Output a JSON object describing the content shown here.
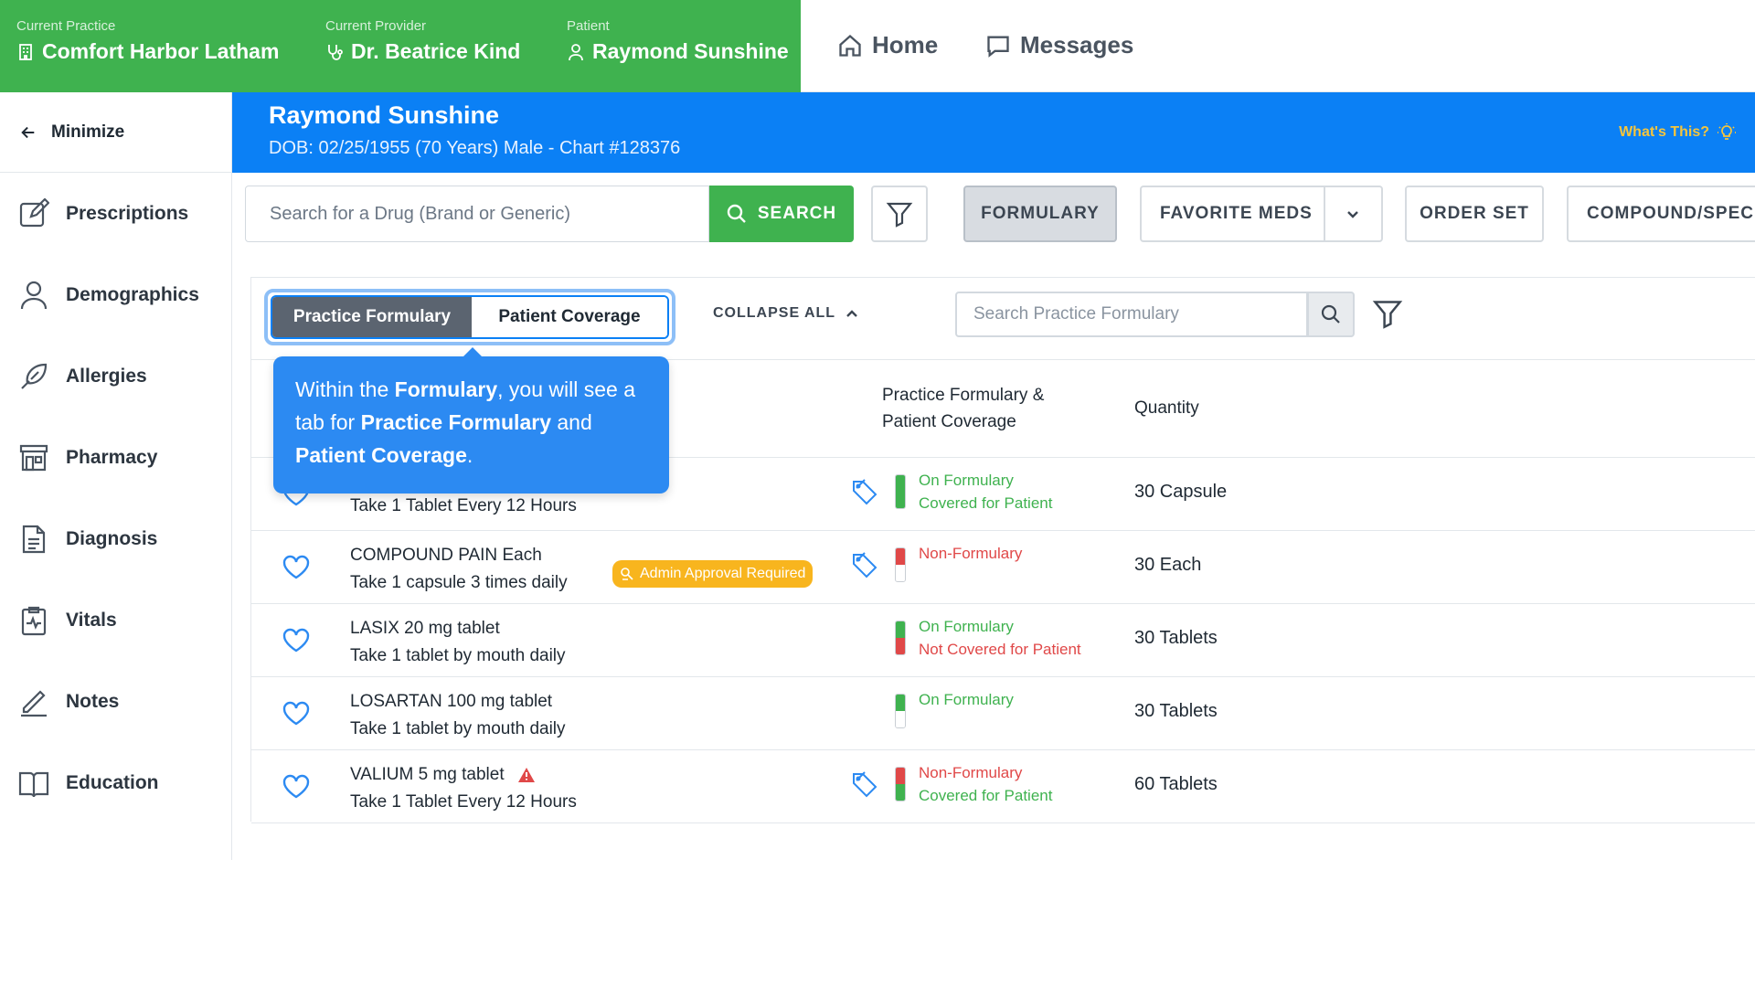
{
  "context": {
    "practice_label": "Current Practice",
    "practice": "Comfort Harbor Latham",
    "provider_label": "Current Provider",
    "provider": "Dr. Beatrice Kind",
    "patient_label": "Patient",
    "patient": "Raymond Sunshine"
  },
  "topnav": {
    "home": "Home",
    "messages": "Messages"
  },
  "sidebar": {
    "minimize": "Minimize",
    "items": [
      {
        "label": "Prescriptions",
        "icon": "edit-icon"
      },
      {
        "label": "Demographics",
        "icon": "user-icon"
      },
      {
        "label": "Allergies",
        "icon": "allergy-icon"
      },
      {
        "label": "Pharmacy",
        "icon": "pharmacy-icon"
      },
      {
        "label": "Diagnosis",
        "icon": "document-icon"
      },
      {
        "label": "Vitals",
        "icon": "vitals-icon"
      },
      {
        "label": "Notes",
        "icon": "pen-icon"
      },
      {
        "label": "Education",
        "icon": "book-icon"
      }
    ]
  },
  "banner": {
    "name": "Raymond Sunshine",
    "info": "DOB: 02/25/1955 (70 Years) Male - Chart #128376",
    "whats_this": "What's This?"
  },
  "toolbar": {
    "search_placeholder": "Search for a Drug (Brand or Generic)",
    "search_label": "SEARCH",
    "formulary": "FORMULARY",
    "favorite_meds": "FAVORITE MEDS",
    "order_set": "ORDER SET",
    "compound": "COMPOUND/SPECI"
  },
  "formulary": {
    "tab_practice": "Practice Formulary",
    "tab_patient": "Patient Coverage",
    "collapse_all": "COLLAPSE ALL",
    "search_placeholder": "Search Practice Formulary",
    "col_coverage_1": "Practice Formulary &",
    "col_coverage_2": "Patient Coverage",
    "col_quantity": "Quantity",
    "rows": [
      {
        "name": "",
        "strength": "",
        "sig": "Take 1 Tablet Every 12 Hours",
        "status1": "On Formulary",
        "status2": "Covered for Patient",
        "qty": "30 Capsule"
      },
      {
        "name": "COMPOUND PAIN",
        "strength": " Each",
        "sig": "Take 1 capsule 3 times daily",
        "badge": "Admin Approval Required",
        "status1": "Non-Formulary",
        "status2": "",
        "qty": "30 Each"
      },
      {
        "name": "LASIX",
        "strength": " 20 mg tablet",
        "sig": "Take 1 tablet by mouth daily",
        "status1": "On Formulary",
        "status2": "Not Covered for Patient",
        "qty": "30 Tablets"
      },
      {
        "name": "LOSARTAN",
        "strength": " 100 mg tablet",
        "sig": "Take 1 tablet by mouth daily",
        "status1": "On Formulary",
        "status2": "",
        "qty": "30 Tablets"
      },
      {
        "name": "VALIUM",
        "strength": " 5 mg tablet",
        "sig": "Take 1 Tablet Every 12 Hours",
        "status1": "Non-Formulary",
        "status2": "Covered for Patient",
        "qty": "60 Tablets"
      }
    ]
  },
  "tooltip": {
    "p1": "Within the ",
    "b1": "Formulary",
    "p2": ", you will see a tab for ",
    "b2": "Practice Formulary",
    "p3": " and ",
    "b3": "Patient Coverage",
    "p4": "."
  },
  "colors": {
    "green": "#3fb24f",
    "blue": "#0b80f5",
    "red": "#e04848",
    "badge": "#f8b51e"
  }
}
